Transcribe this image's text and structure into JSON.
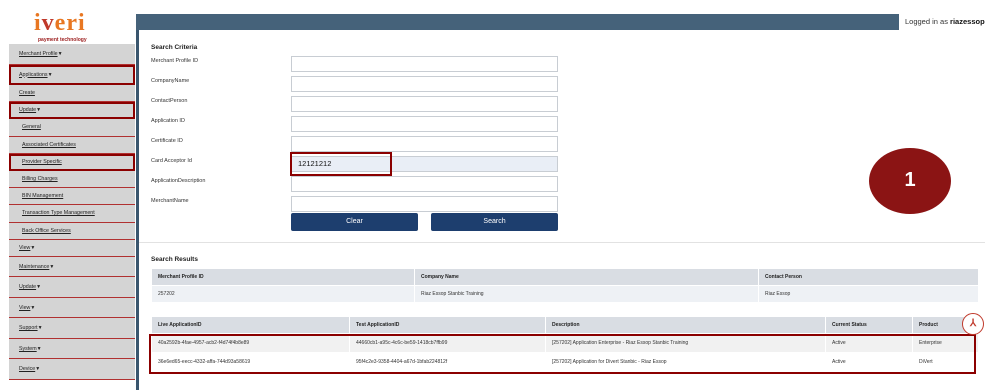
{
  "logo": {
    "word_a": "i",
    "word_v": "v",
    "word_b": "eri",
    "subtitle": "payment technology"
  },
  "login": {
    "prefix": "Logged in as",
    "user": "riazessop"
  },
  "sidebar": {
    "items": [
      {
        "label": "Merchant Profile",
        "caret": true
      },
      {
        "label": "Applications",
        "caret": true
      },
      {
        "label": "Create",
        "caret": false
      },
      {
        "label": "Update",
        "caret": true
      },
      {
        "label": "General",
        "caret": false
      },
      {
        "label": "Associated Certificates",
        "caret": false
      },
      {
        "label": "Provider Specific",
        "caret": false
      },
      {
        "label": "Billing Charges",
        "caret": false
      },
      {
        "label": "BIN Management",
        "caret": false
      },
      {
        "label": "Transaction Type Management",
        "caret": false
      },
      {
        "label": "Back Office Services",
        "caret": false
      },
      {
        "label": "View",
        "caret": true
      },
      {
        "label": "Maintenance",
        "caret": true
      },
      {
        "label": "Update",
        "caret": true
      },
      {
        "label": "View",
        "caret": true
      },
      {
        "label": "Support",
        "caret": true
      },
      {
        "label": "System",
        "caret": true
      },
      {
        "label": "Device",
        "caret": true
      }
    ],
    "caret_glyph": "▼"
  },
  "search": {
    "title": "Search Criteria",
    "fields": [
      {
        "label": "Merchant Profile ID",
        "value": ""
      },
      {
        "label": "CompanyName",
        "value": ""
      },
      {
        "label": "ContactPerson",
        "value": ""
      },
      {
        "label": "Application ID",
        "value": ""
      },
      {
        "label": "Certificate ID",
        "value": ""
      },
      {
        "label": "Card Acceptor Id",
        "value": "12121212"
      },
      {
        "label": "ApplicationDescription",
        "value": ""
      },
      {
        "label": "MerchantName",
        "value": ""
      }
    ],
    "clear_label": "Clear",
    "search_label": "Search"
  },
  "badge": {
    "number": "1"
  },
  "results": {
    "title": "Search Results",
    "merchant_table": {
      "headers": [
        "Merchant Profile ID",
        "Company Name",
        "Contact Person"
      ],
      "rows": [
        [
          "257202",
          "Riaz Essop Stanbic Training",
          "Riaz Essop"
        ]
      ]
    },
    "app_table": {
      "headers": [
        "Live ApplicationID",
        "Test ApplicationID",
        "Description",
        "Current Status",
        "Product"
      ],
      "rows": [
        [
          "40a2592b-4fae-4957-acb2-f4d74f4b8e89",
          "44660cb1-a95c-4c6c-be59-1418cb7ffb99",
          "[257202] Application Enterprise - Riaz Essop Stanbic Training",
          "Active",
          "Enterprise"
        ],
        [
          "36e6ed65-eecc-4332-affa-744d93a58619",
          "95f4c2e3-9358-4404-a67d-1bfab224812f",
          "[257202] Application for Divert Stanbic - Riaz Essop",
          "Active",
          "DiVert"
        ]
      ]
    },
    "pdf_icon_glyph": "⅄"
  }
}
